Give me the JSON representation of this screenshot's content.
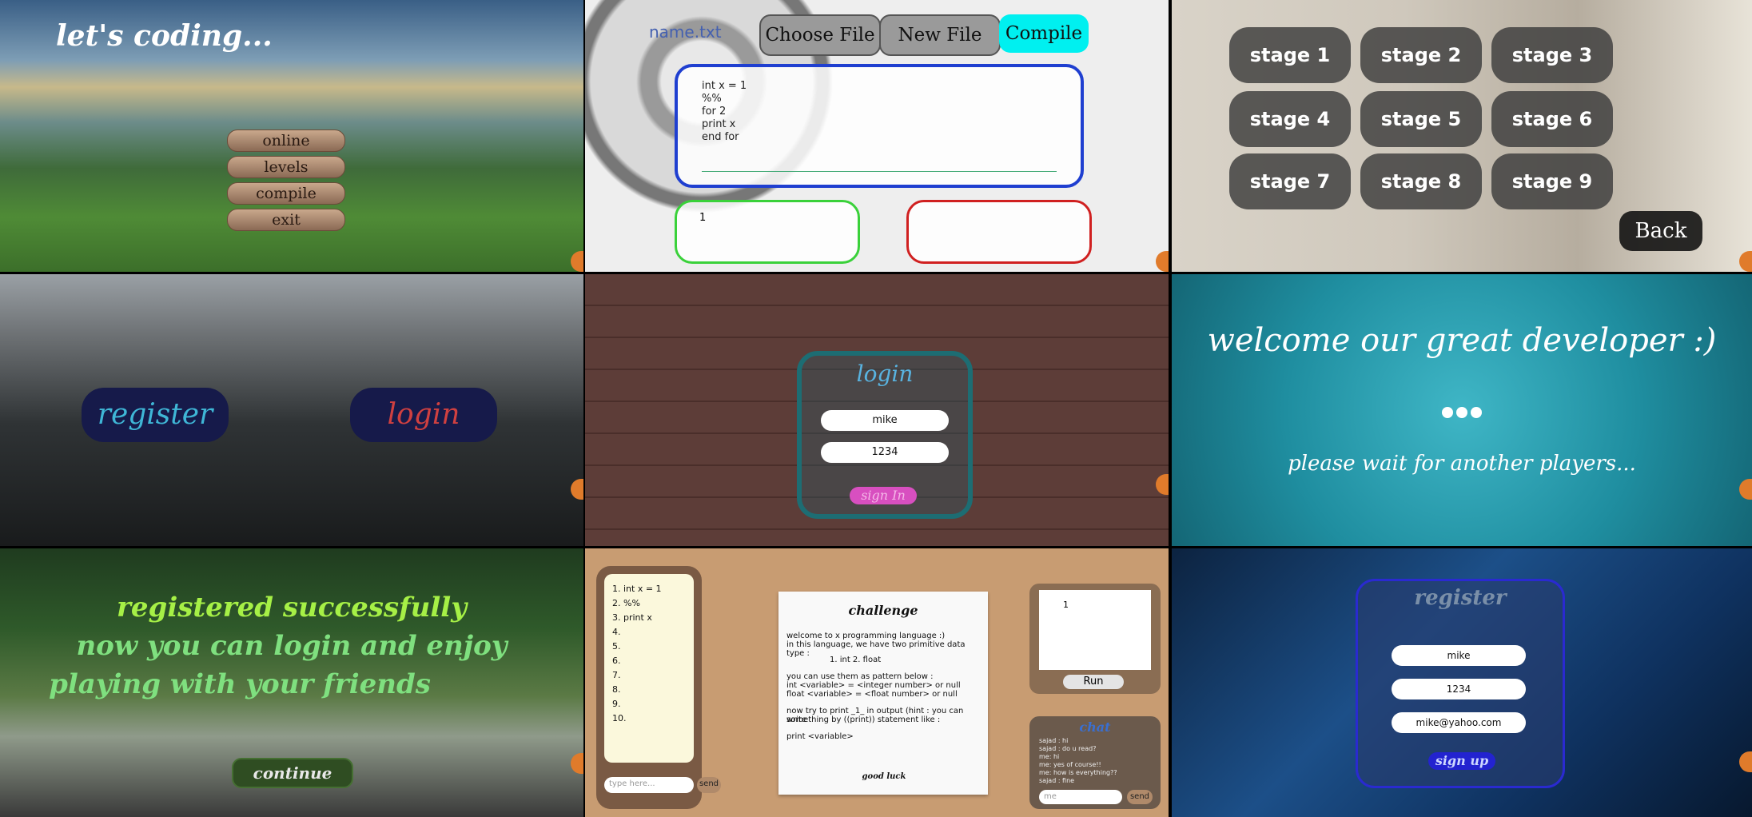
{
  "main_menu": {
    "title": "let's coding...",
    "buttons": [
      "online",
      "levels",
      "compile",
      "exit"
    ]
  },
  "compiler": {
    "file_name": "name.txt",
    "choose_file": "Choose File",
    "new_file": "New File",
    "compile": "Compile",
    "code_lines": [
      "int x = 1",
      "%%",
      "for 2",
      "print x",
      "end for"
    ],
    "output": "1",
    "errors": ""
  },
  "levels": {
    "stages": [
      "stage 1",
      "stage 2",
      "stage 3",
      "stage 4",
      "stage 5",
      "stage 6",
      "stage 7",
      "stage 8",
      "stage 9"
    ],
    "back": "Back"
  },
  "auth_choice": {
    "register": "register",
    "login": "login"
  },
  "login": {
    "title": "login",
    "username": "mike",
    "password": "1234",
    "sign_in": "sign In"
  },
  "waiting": {
    "welcome": "welcome our great developer :)",
    "wait": "please wait for another players..."
  },
  "registered": {
    "lines": [
      "registered successfully",
      "now you can login and enjoy",
      "playing with your friends"
    ],
    "continue": "continue"
  },
  "game": {
    "code_lines": [
      "1.  int x = 1",
      "2.  %%",
      "3.  print x",
      "4.",
      "5.",
      "6.",
      "7.",
      "8.",
      "9.",
      "10."
    ],
    "code_placeholder": "type here...",
    "send": "send",
    "challenge_title": "challenge",
    "challenge_text": [
      "welcome to x programming language :)",
      "in this language, we have two primitive data type :",
      "1. int              2. float",
      "you can use them as pattern below :",
      "int <variable> = <integer number> or null",
      "float <variable> = <float number> or null",
      "now try to print _1_ in output (hint : you can write",
      "something by ((print)) statement like :",
      "print <variable>"
    ],
    "good_luck": "good luck",
    "tv_output": "1",
    "run": "Run",
    "chat_title": "chat",
    "chat_messages": [
      "sajad : hi",
      "sajad : do u read?",
      "me: hi",
      "me: yes of course!!",
      "me: how is everything??",
      "sajad : fine"
    ],
    "chat_placeholder": "me",
    "chat_send": "send"
  },
  "register": {
    "title": "register",
    "username": "mike",
    "password": "1234",
    "email": "mike@yahoo.com",
    "sign_up": "sign up"
  },
  "colors": {
    "compile_accent": "#00f0f0",
    "editor_border": "#1f3fd0",
    "output_border": "#3ad13a",
    "error_border": "#d02020",
    "login_pink": "#d84fc0",
    "register_blue": "#2323d0"
  }
}
